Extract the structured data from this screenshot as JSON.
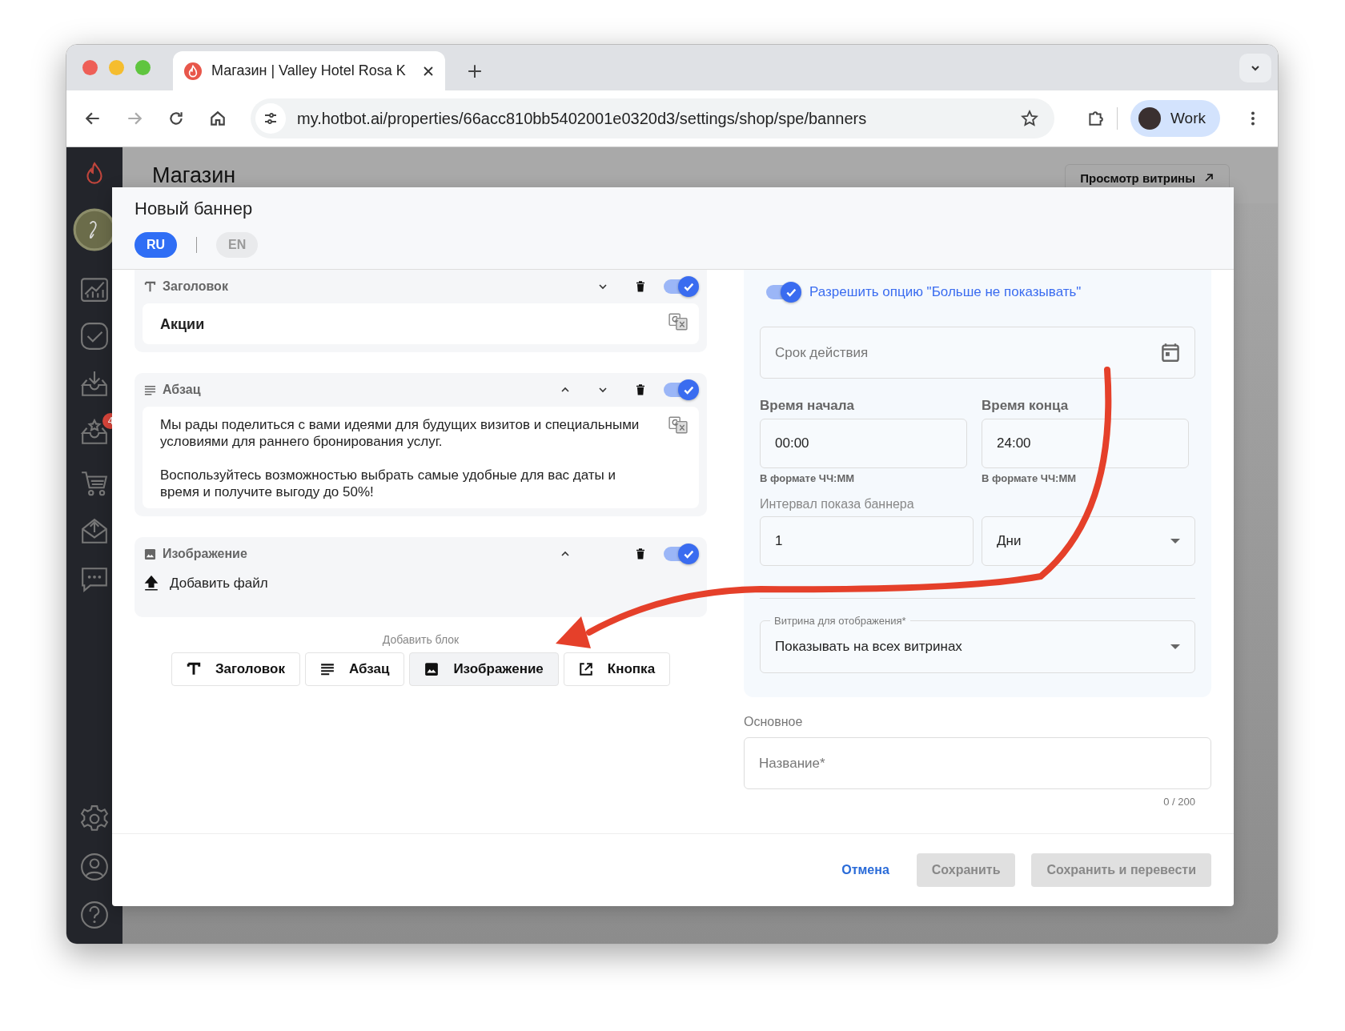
{
  "browser": {
    "tab_title": "Магазин | Valley Hotel Rosa K",
    "url": "my.hotbot.ai/properties/66acc810bb5402001e0320d3/settings/shop/spe/banners",
    "profile": "Work"
  },
  "sidebar": {
    "badge": "4"
  },
  "page": {
    "title": "Магазин",
    "storefront_button": "Просмотр витрины"
  },
  "modal": {
    "title": "Новый баннер",
    "languages": [
      {
        "label": "RU",
        "selected": true
      },
      {
        "label": "EN",
        "selected": false
      }
    ],
    "blocks": [
      {
        "kind": "heading",
        "label": "Заголовок",
        "move_up": false,
        "move_down": true,
        "enabled": true,
        "text": "Акции"
      },
      {
        "kind": "paragraph",
        "label": "Абзац",
        "move_up": true,
        "move_down": true,
        "enabled": true,
        "paragraphs": [
          "Мы рады поделиться с вами идеями для будущих визитов и специальными условиями для раннего бронирования услуг.",
          "Воспользуйтесь возможностью выбрать самые удобные для вас даты и время и получите выгоду до 50%!"
        ]
      },
      {
        "kind": "image",
        "label": "Изображение",
        "move_up": true,
        "move_down": false,
        "enabled": true,
        "upload": "Добавить файл"
      }
    ],
    "add_block": {
      "label": "Добавить блок",
      "buttons": [
        {
          "kind": "heading",
          "label": "Заголовок",
          "selected": false
        },
        {
          "kind": "paragraph",
          "label": "Абзац",
          "selected": false
        },
        {
          "kind": "image",
          "label": "Изображение",
          "selected": true
        },
        {
          "kind": "button",
          "label": "Кнопка",
          "selected": false
        }
      ]
    },
    "settings": {
      "dont_show_again": {
        "label": "Разрешить опцию \"Больше не показывать\"",
        "on": true
      },
      "validity": {
        "placeholder": "Срок действия"
      },
      "start_time": {
        "label": "Время начала",
        "value": "00:00",
        "hint": "В формате ЧЧ:ММ"
      },
      "end_time": {
        "label": "Время конца",
        "value": "24:00",
        "hint": "В формате ЧЧ:ММ"
      },
      "interval": {
        "label": "Интервал показа баннера",
        "value": "1",
        "unit": "Дни"
      },
      "storefront": {
        "label": "Витрина для отображения*",
        "value": "Показывать на всех витринах"
      }
    },
    "basic": {
      "title": "Основное",
      "name_placeholder": "Название*",
      "counter": "0 / 200"
    },
    "footer": {
      "cancel": "Отмена",
      "save": "Сохранить",
      "save_translate": "Сохранить и перевести",
      "save_disabled": true
    }
  }
}
